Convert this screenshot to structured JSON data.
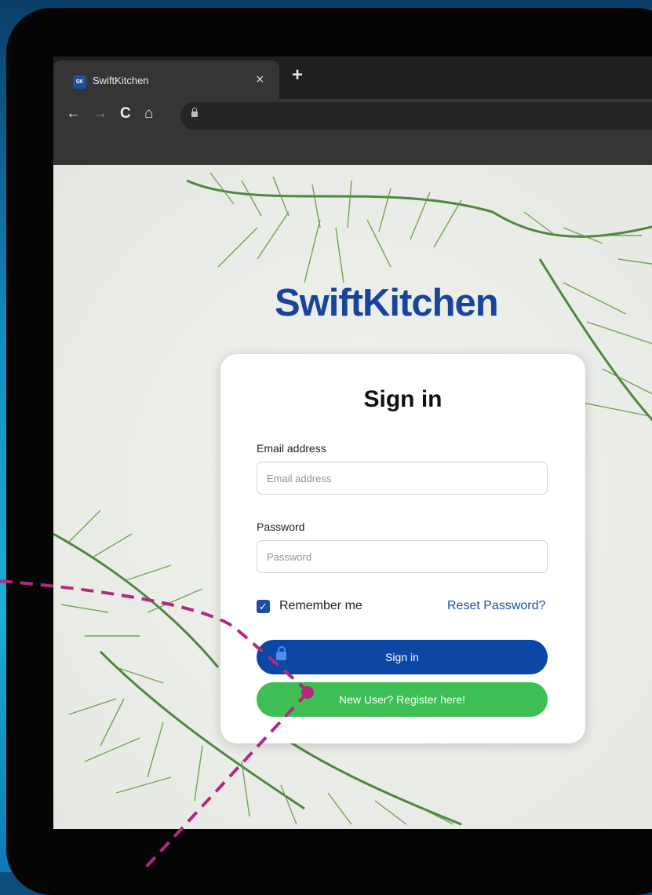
{
  "browser": {
    "tab_title": "SwiftKitchen",
    "favicon_text": "SK",
    "close_glyph": "×",
    "new_tab_glyph": "+",
    "back_glyph": "←",
    "forward_glyph": "→",
    "reload_glyph": "C",
    "home_glyph": "⌂"
  },
  "page": {
    "brand": "SwiftKitchen",
    "form": {
      "title": "Sign in",
      "email_label": "Email address",
      "email_placeholder": "Email address",
      "password_label": "Password",
      "password_placeholder": "Password",
      "remember_label": "Remember me",
      "remember_checked": true,
      "checkbox_glyph": "✓",
      "reset_link": "Reset Password?",
      "signin_button": "Sign in",
      "register_button": "New User? Register here!"
    }
  },
  "colors": {
    "brand_blue": "#19449d",
    "signin_blue": "#0c47a6",
    "register_green": "#3dbf55",
    "annotation_magenta": "#b5287f"
  },
  "icons": [
    "lock-icon",
    "plus-icon",
    "close-icon",
    "back-arrow-icon",
    "forward-arrow-icon",
    "reload-icon",
    "home-icon"
  ]
}
